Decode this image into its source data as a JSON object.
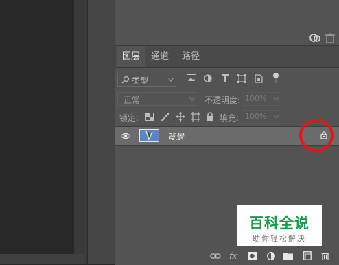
{
  "tabs": [
    "图层",
    "通道",
    "路径"
  ],
  "filter": {
    "icon": "search-icon",
    "label": "类型"
  },
  "blend_mode": "正常",
  "opacity": {
    "label": "不透明度:",
    "value": "100%"
  },
  "lock_label": "锁定:",
  "fill": {
    "label": "填充:",
    "value": "100%"
  },
  "layer": {
    "name": "背景"
  },
  "watermark": {
    "title": "百科全说",
    "subtitle": "助你轻松解决"
  },
  "colors": {
    "highlight_circle": "#e01818",
    "watermark_green": "#1a9b4b",
    "panel": "#535353"
  }
}
